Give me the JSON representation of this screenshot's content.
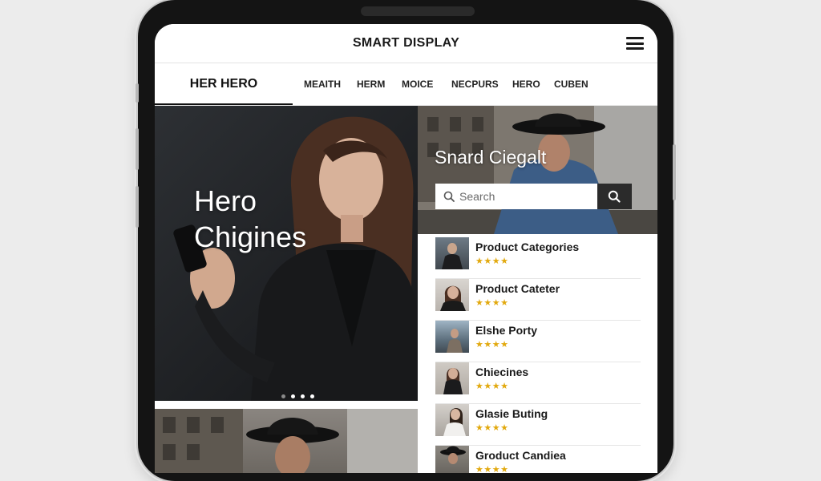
{
  "app": {
    "title": "SMART DISPLAY"
  },
  "nav": {
    "brand": "HER HERO",
    "tabs": [
      {
        "label": "MEAITH"
      },
      {
        "label": "HERM"
      },
      {
        "label": "MOICE"
      },
      {
        "label": "NECPURS"
      },
      {
        "label": "HERO"
      },
      {
        "label": "CUBEN"
      }
    ]
  },
  "hero": {
    "title_line1": "Hero",
    "title_line2": "Chigines",
    "slides": 4,
    "active_slide": 2
  },
  "promo": {
    "title": "Snard Ciegalt",
    "search": {
      "placeholder": "Search"
    }
  },
  "products": [
    {
      "name": "Product Categories",
      "stars": "★★★★",
      "rating": 4
    },
    {
      "name": "Product Cateter",
      "stars": "★★★★",
      "rating": 4
    },
    {
      "name": "Elshe Porty",
      "stars": "★★★★",
      "rating": 4
    },
    {
      "name": "Chiecines",
      "stars": "★★★★",
      "rating": 4
    },
    {
      "name": "Glasie Buting",
      "stars": "★★★★",
      "rating": 4
    },
    {
      "name": "Groduct Candiea",
      "stars": "★★★★",
      "rating": 4
    }
  ],
  "icons": {
    "menu": "hamburger-menu-icon",
    "search": "search-icon"
  },
  "colors": {
    "star": "#e2a90e",
    "search_button": "#2b2b2b",
    "hero_background": "#1e2023"
  }
}
